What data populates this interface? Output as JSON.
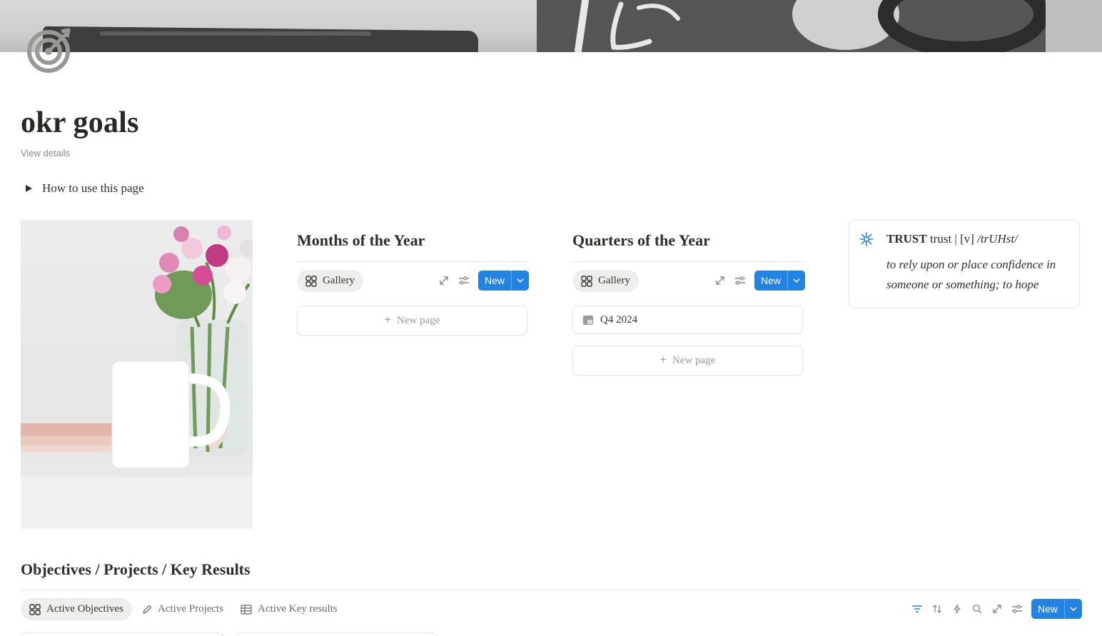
{
  "page": {
    "title": "okr goals",
    "view_details": "View details",
    "toggle_label": "How to use this page"
  },
  "months": {
    "title": "Months of the Year",
    "view_label": "Gallery",
    "new_label": "New",
    "new_page_label": "New page"
  },
  "quarters": {
    "title": "Quarters of the Year",
    "view_label": "Gallery",
    "new_label": "New",
    "items": [
      "Q4 2024"
    ],
    "new_page_label": "New page"
  },
  "callout": {
    "word": "TRUST",
    "lower": "trust",
    "part": "| [v]",
    "pron": "/trUHst/",
    "definition": "to rely upon or place confidence in someone or something; to hope"
  },
  "okr": {
    "title": "Objectives / Projects / Key Results",
    "tabs": [
      "Active Objectives",
      "Active Projects",
      "Active Key results"
    ],
    "new_label": "New"
  },
  "colors": {
    "accent": "#2383e2",
    "callout_icon": "#2383e2",
    "text": "#2f2d2a",
    "muted": "#9b9a97"
  },
  "icons": {
    "page": "target-icon",
    "callout": "sparkle-icon",
    "gallery": "gallery-icon",
    "projects": "pencil-icon",
    "table": "table-icon"
  }
}
